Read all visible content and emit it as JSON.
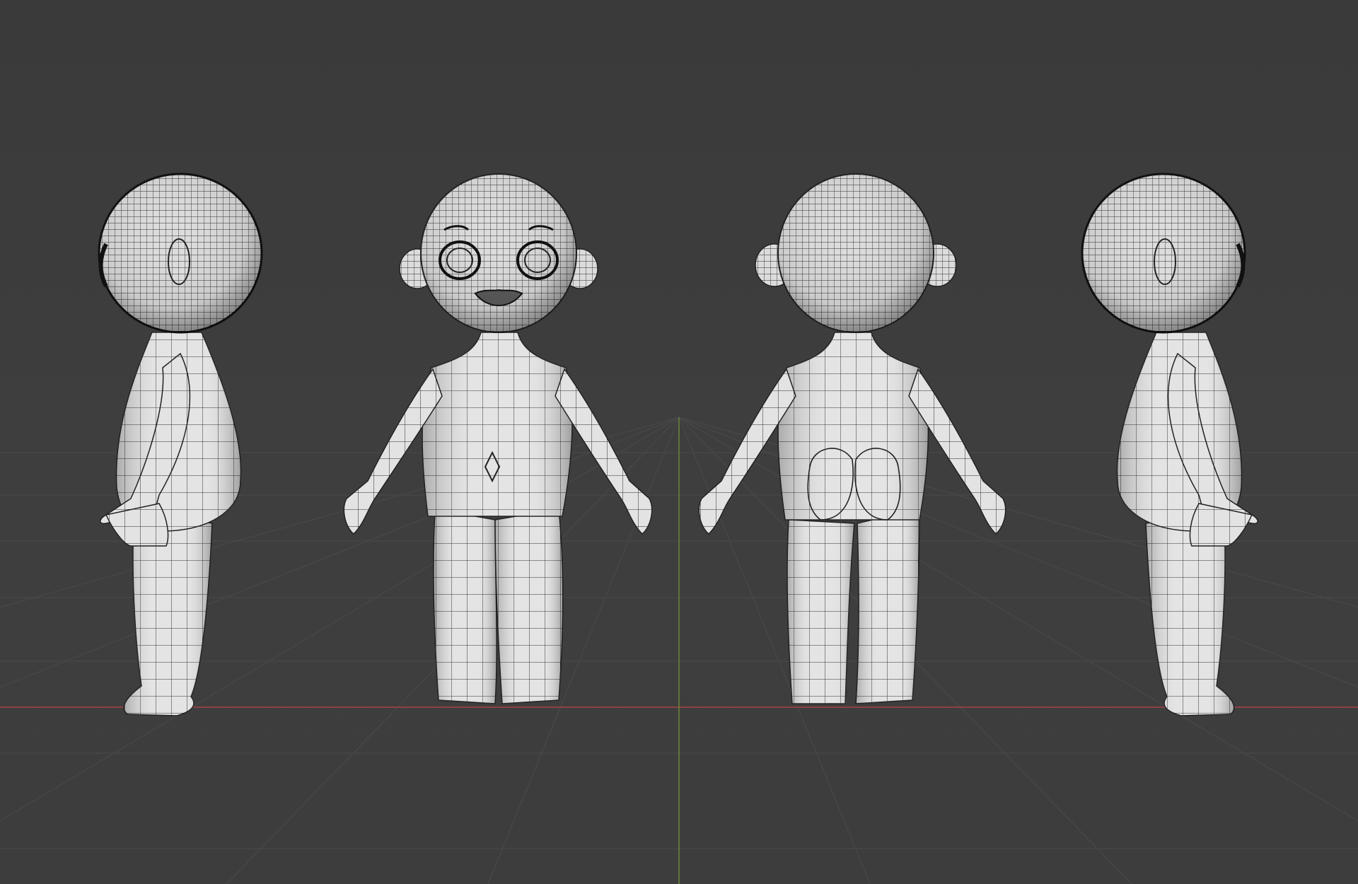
{
  "viewport": {
    "mode": "3d-viewport",
    "background_color": "#3d3d3d",
    "grid_color": "#4a4a4a",
    "x_axis_color": "#b0434a",
    "y_axis_color": "#6f8f3a",
    "shading": "wireframe-on-solid"
  },
  "model": {
    "mesh_color": "#e6e6e6",
    "wire_color": "#1e1e1e",
    "views": [
      "side-left",
      "front",
      "back",
      "side-right"
    ]
  }
}
